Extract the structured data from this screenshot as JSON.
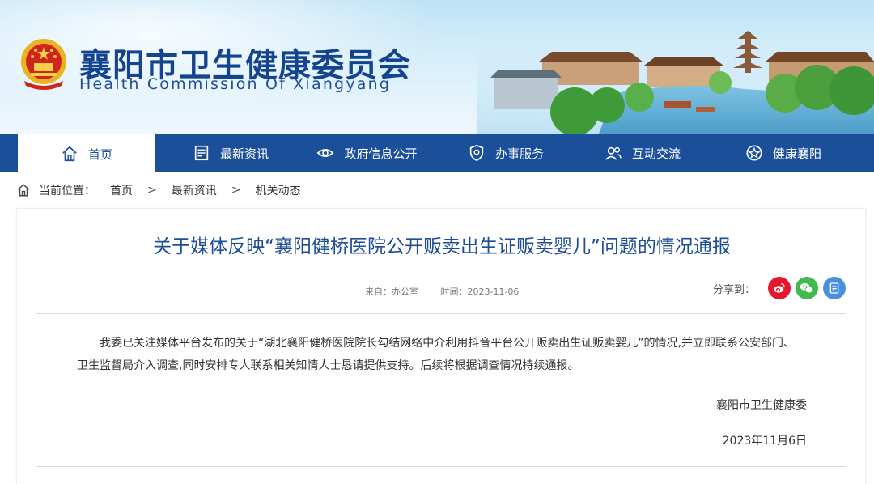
{
  "header": {
    "title": "襄阳市卫生健康委员会",
    "subtitle": "Health Commission Of Xiangyang"
  },
  "nav": {
    "items": [
      {
        "label": "首页",
        "icon": "home-icon"
      },
      {
        "label": "最新资讯",
        "icon": "news-icon"
      },
      {
        "label": "政府信息公开",
        "icon": "eye-icon"
      },
      {
        "label": "办事服务",
        "icon": "shield-icon"
      },
      {
        "label": "互动交流",
        "icon": "chat-icon"
      },
      {
        "label": "健康襄阳",
        "icon": "health-icon"
      }
    ],
    "active": "首页"
  },
  "breadcrumb": {
    "prefix": "当前位置：",
    "items": [
      "首页",
      "最新资讯",
      "机关动态"
    ],
    "separator": ">"
  },
  "article": {
    "title": "关于媒体反映“襄阳健桥医院公开贩卖出生证贩卖婴儿”问题的情况通报",
    "source": "来自：办公室",
    "time": "时间：2023-11-06",
    "share_label": "分享到：",
    "body": "我委已关注媒体平台发布的关于“湖北襄阳健桥医院院长勾结网络中介利用抖音平台公开贩卖出生证贩卖婴儿”的情况,并立即联系公安部门、卫生监督局介入调查,同时安排专人联系相关知情人士恳请提供支持。后续将根据调查情况持续通报。",
    "signature": "襄阳市卫生健康委",
    "date": "2023年11月6日"
  },
  "colors": {
    "nav_bg": "#1b4f9a",
    "title_blue": "#1d4d94",
    "weibo": "#e6162d",
    "wechat": "#3fb950",
    "share_blue": "#4a90e2"
  }
}
